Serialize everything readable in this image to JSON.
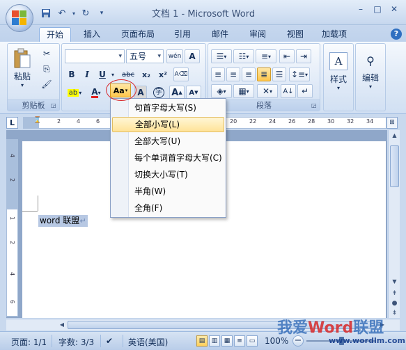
{
  "window": {
    "title": "文档 1 - Microsoft Word",
    "minimize": "–",
    "maximize": "□",
    "close": "✕"
  },
  "qat": {
    "save_icon": "save-icon",
    "undo": "↶",
    "redo": "↻",
    "dropdown": "▾"
  },
  "tabs": [
    {
      "label": "开始",
      "active": true
    },
    {
      "label": "插入"
    },
    {
      "label": "页面布局"
    },
    {
      "label": "引用"
    },
    {
      "label": "邮件"
    },
    {
      "label": "审阅"
    },
    {
      "label": "视图"
    },
    {
      "label": "加载项"
    }
  ],
  "help": "?",
  "ribbon": {
    "clipboard": {
      "paste": "粘贴",
      "label": "剪贴板"
    },
    "font": {
      "font_name": "",
      "font_size": "五号",
      "wen": "wén",
      "bold": "B",
      "italic": "I",
      "underline": "U",
      "strike": "abc",
      "sub": "x₂",
      "sup": "x²",
      "change_case": "Aa",
      "char_border": "A",
      "enclose": "字",
      "grow": "A",
      "shrink": "A",
      "font_color": "A"
    },
    "paragraph": {
      "label": "段落"
    },
    "styles": {
      "label": "样式"
    },
    "editing": {
      "label": "编辑"
    }
  },
  "ruler": {
    "corner": "L",
    "ticks": [
      "2",
      "4",
      "6",
      "20",
      "22",
      "24",
      "26",
      "28",
      "30",
      "32",
      "34"
    ],
    "vticks": [
      "4",
      "2",
      "1",
      "2",
      "4",
      "6"
    ]
  },
  "menu": {
    "items": [
      {
        "label": "句首字母大写(S)"
      },
      {
        "label": "全部小写(L)",
        "hover": true
      },
      {
        "label": "全部大写(U)"
      },
      {
        "label": "每个单词首字母大写(C)"
      },
      {
        "label": "切换大小写(T)"
      },
      {
        "label": "半角(W)"
      },
      {
        "label": "全角(F)"
      }
    ]
  },
  "document": {
    "text": "word 联盟",
    "para_mark": "↵"
  },
  "status": {
    "page": "页面: 1/1",
    "words": "字数: 3/3",
    "language": "英语(美国)",
    "zoom": "100%",
    "zoom_minus": "−"
  },
  "watermark": {
    "part1": "我爱",
    "part2": "Word",
    "part3": "联盟",
    "url": "www.wordlm.com"
  }
}
